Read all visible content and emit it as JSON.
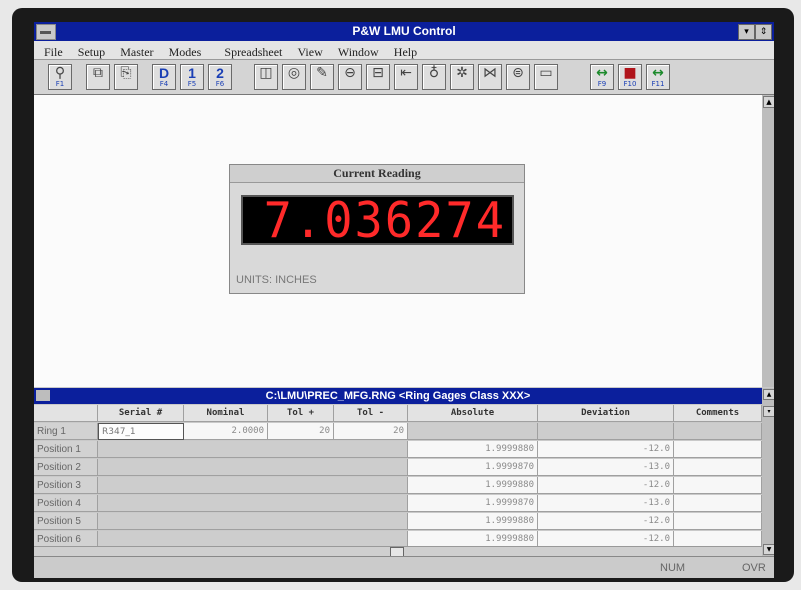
{
  "window": {
    "title": "P&W LMU Control",
    "minimize": "▾",
    "maximize": "⇕"
  },
  "menu": [
    "File",
    "Setup",
    "Master",
    "Modes",
    "Spreadsheet",
    "View",
    "Window",
    "Help"
  ],
  "toolbar": {
    "buttons": [
      {
        "icon": "probe-icon",
        "symbol": "⚲",
        "key": "F1"
      },
      {
        "icon": "copy-pages-icon",
        "symbol": "⧉",
        "key": ""
      },
      {
        "icon": "paste-icon",
        "symbol": "⎘",
        "key": ""
      },
      {
        "icon": "d-icon",
        "symbol": "D",
        "key": "F4"
      },
      {
        "icon": "one-icon",
        "symbol": "1",
        "key": "F5"
      },
      {
        "icon": "two-icon",
        "symbol": "2",
        "key": "F6"
      },
      {
        "icon": "square-icon",
        "symbol": "◫",
        "key": ""
      },
      {
        "icon": "ring-icon",
        "symbol": "◎",
        "key": ""
      },
      {
        "icon": "pencil-icon",
        "symbol": "✎",
        "key": ""
      },
      {
        "icon": "disc-icon",
        "symbol": "⊖",
        "key": ""
      },
      {
        "icon": "gage-icon",
        "symbol": "⊟",
        "key": ""
      },
      {
        "icon": "plug-icon",
        "symbol": "⇤",
        "key": ""
      },
      {
        "icon": "bulb-icon",
        "symbol": "♁",
        "key": ""
      },
      {
        "icon": "gear-icon",
        "symbol": "✲",
        "key": ""
      },
      {
        "icon": "fixture-icon",
        "symbol": "⋈",
        "key": ""
      },
      {
        "icon": "cylinder-icon",
        "symbol": "⊜",
        "key": ""
      },
      {
        "icon": "bar-icon",
        "symbol": "▭",
        "key": ""
      },
      {
        "icon": "green-arrows-icon",
        "symbol": "↔",
        "key": "F9"
      },
      {
        "icon": "stop-icon",
        "symbol": "■",
        "key": "F10"
      },
      {
        "icon": "green-arrows-2-icon",
        "symbol": "↔",
        "key": "F11"
      }
    ]
  },
  "reading": {
    "title": "Current Reading",
    "value": "7.036274",
    "units": "UNITS: INCHES"
  },
  "spreadsheet": {
    "title": "C:\\LMU\\PREC_MFG.RNG  <Ring Gages Class XXX>",
    "columns": [
      "Serial #",
      "Nominal",
      "Tol +",
      "Tol -",
      "Absolute",
      "Deviation",
      "Comments"
    ],
    "ring": {
      "label": "Ring 1",
      "serial": "R347_1",
      "nominal": "2.0000",
      "tol_plus": "20",
      "tol_minus": "20"
    },
    "rows": [
      {
        "label": "Position 1",
        "absolute": "1.9999880",
        "deviation": "-12.0"
      },
      {
        "label": "Position 2",
        "absolute": "1.9999870",
        "deviation": "-13.0"
      },
      {
        "label": "Position 3",
        "absolute": "1.9999880",
        "deviation": "-12.0"
      },
      {
        "label": "Position 4",
        "absolute": "1.9999870",
        "deviation": "-13.0"
      },
      {
        "label": "Position 5",
        "absolute": "1.9999880",
        "deviation": "-12.0"
      },
      {
        "label": "Position 6",
        "absolute": "1.9999880",
        "deviation": "-12.0"
      }
    ]
  },
  "status": {
    "num": "NUM",
    "ovr": "OVR"
  }
}
